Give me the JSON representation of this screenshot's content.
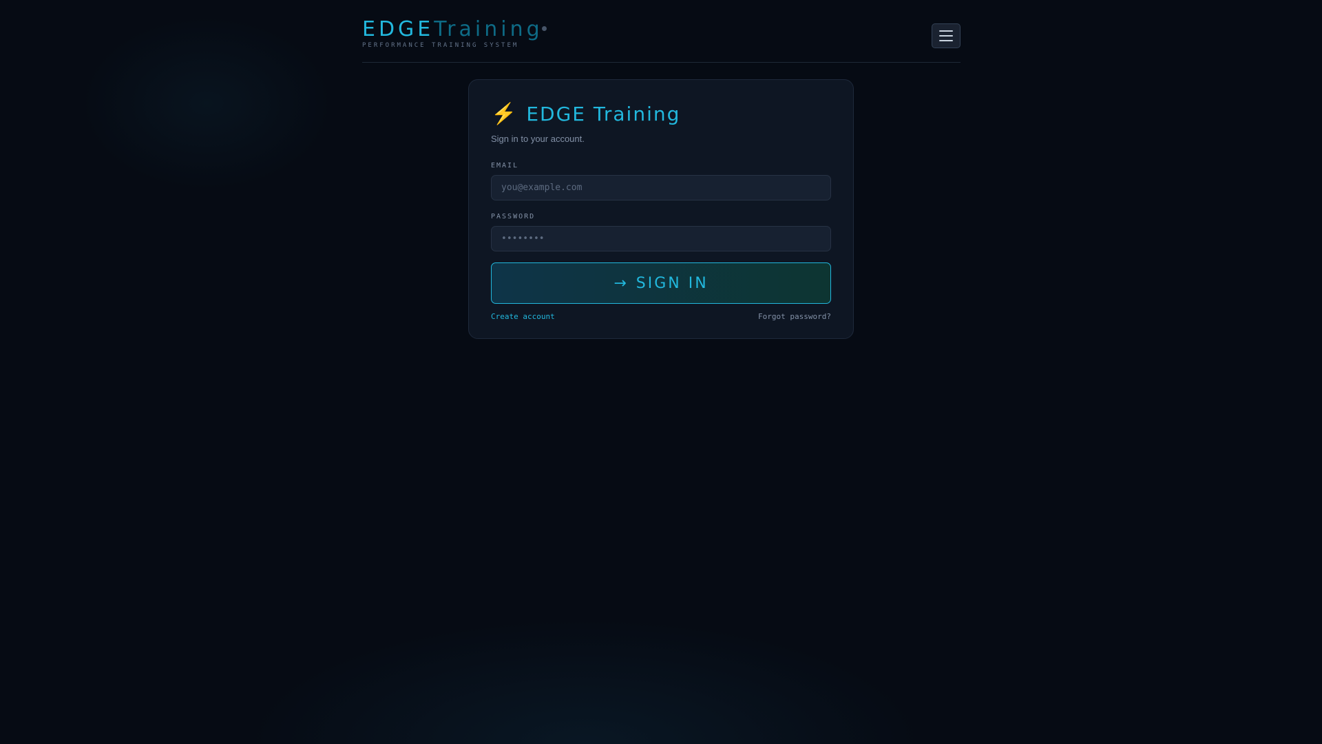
{
  "header": {
    "logo_edge": "EDGE",
    "logo_training": "Training",
    "logo_subtitle": "PERFORMANCE TRAINING SYSTEM",
    "menu_icon": "hamburger-menu-icon"
  },
  "card": {
    "icon": "lightning-bolt-icon",
    "icon_glyph": "⚡",
    "title": "EDGE Training",
    "subtitle": "Sign in to your account."
  },
  "form": {
    "email_label": "EMAIL",
    "email_placeholder": "you@example.com",
    "email_value": "",
    "password_label": "PASSWORD",
    "password_placeholder": "••••••••",
    "password_value": "",
    "submit_arrow": "→",
    "submit_label": "SIGN IN"
  },
  "links": {
    "create_account": "Create account",
    "forgot_password": "Forgot password?"
  },
  "colors": {
    "accent": "#22b8de",
    "accent_dim": "#0e6b86",
    "background": "#060b14",
    "card": "#0e1623",
    "bolt": "#f5b800"
  }
}
